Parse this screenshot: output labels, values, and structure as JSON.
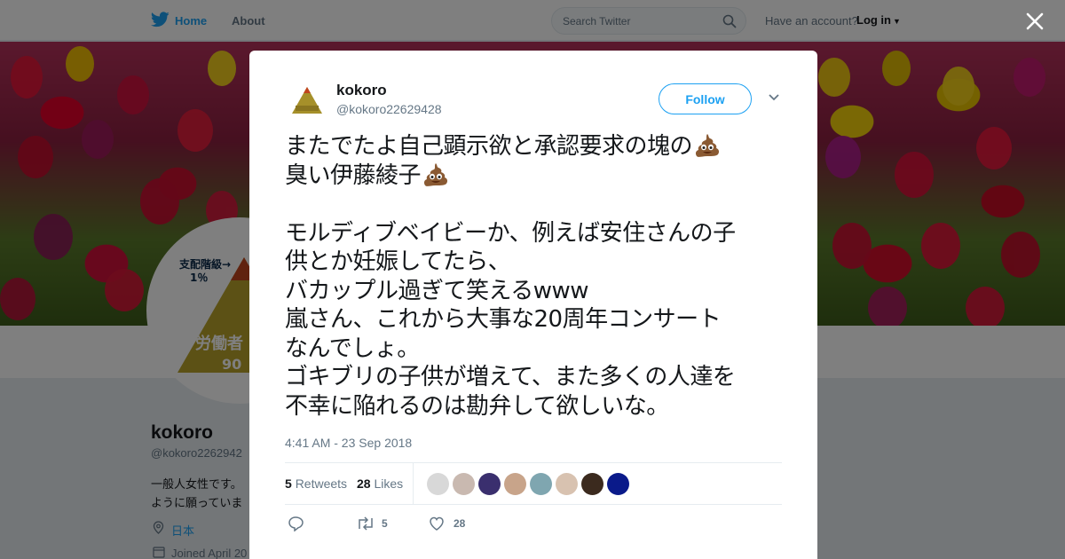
{
  "nav": {
    "home": "Home",
    "about": "About",
    "search_placeholder": "Search Twitter",
    "have_account": "Have an account?",
    "login": "Log in"
  },
  "profile": {
    "name": "kokoro",
    "handle": "@kokoro2262942",
    "bio_line1": "一般人女性です。",
    "bio_line2": "ように願っていま",
    "location": "日本",
    "joined": "Joined April 20",
    "avatar_text_top": "支配階級→",
    "avatar_text_pct": "1％",
    "avatar_text_bottom": "労働者",
    "avatar_text_num": "90"
  },
  "tweet": {
    "name": "kokoro",
    "handle": "@kokoro22629428",
    "follow_label": "Follow",
    "lines": [
      "またでたよ自己顕示欲と承認要求の塊の",
      "臭い伊藤綾子",
      "",
      "モルディブベイビーか、例えば安住さんの子",
      "供とか妊娠してたら、",
      "バカップル過ぎて笑えるwww",
      "嵐さん、これから大事な20周年コンサート",
      "なんでしょ。",
      "ゴキブリの子供が増えて、また多くの人達を",
      "不幸に陥れるのは勘弁して欲しいな。"
    ],
    "emoji": "pile-of-poo",
    "timestamp": "4:41 AM - 23 Sep 2018",
    "retweets_count": "5",
    "retweets_label": "Retweets",
    "likes_count": "28",
    "likes_label": "Likes",
    "action_retweets": "5",
    "action_likes": "28"
  },
  "colors": {
    "accent": "#1da1f2",
    "text": "#14171a",
    "muted": "#657786"
  },
  "liker_colors": [
    "#d8d8d8",
    "#c9b9b0",
    "#3a2f6e",
    "#c8a48a",
    "#7fa6b0",
    "#d8c2b0",
    "#3b2a1e",
    "#0a1a8a"
  ],
  "icons": [
    "twitter-bird-icon",
    "search-icon",
    "caret-down-icon",
    "close-icon",
    "location-icon",
    "calendar-icon",
    "reply-icon",
    "retweet-icon",
    "heart-icon",
    "pile-of-poo-icon"
  ]
}
